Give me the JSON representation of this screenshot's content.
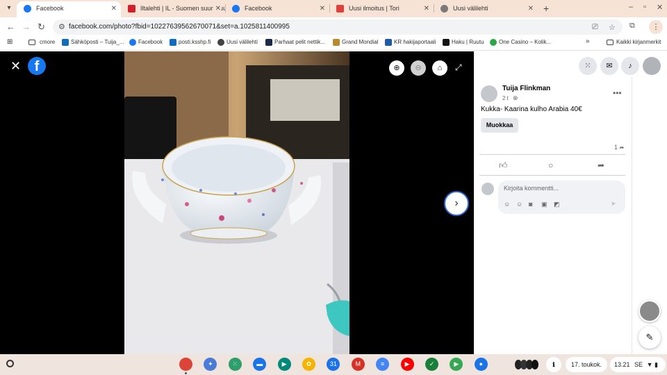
{
  "tabs": [
    {
      "title": "Facebook",
      "icon": "facebook-icon",
      "color": "#1877f2",
      "active": true
    },
    {
      "title": "Iltalehti | IL - Suomen suurin uu",
      "icon": "iltalehti-icon",
      "color": "#d21f2b",
      "active": false
    },
    {
      "title": "Facebook",
      "icon": "facebook-icon",
      "color": "#1877f2",
      "active": false
    },
    {
      "title": "Uusi ilmoitus | Tori",
      "icon": "tori-icon",
      "color": "#e0403a",
      "active": false
    },
    {
      "title": "Uusi välilehti",
      "icon": "chrome-icon",
      "color": "#7a7a7a",
      "active": false
    }
  ],
  "address": {
    "url": "facebook.com/photo?fbid=10227639562670071&set=a.1025811400995"
  },
  "bookmarks": [
    {
      "label": "cmore",
      "icon": "folder-icon",
      "color": "#ffffff"
    },
    {
      "label": "Sähköposti – Tuija_...",
      "icon": "outlook-icon",
      "color": "#0f6cbd"
    },
    {
      "label": "Facebook",
      "icon": "facebook-icon",
      "color": "#1877f2"
    },
    {
      "label": "posti.ksshp.fi",
      "icon": "outlook-icon",
      "color": "#0f6cbd"
    },
    {
      "label": "Uusi välilehti",
      "icon": "chrome-icon",
      "color": "#444444"
    },
    {
      "label": "Parhaat pelit nettik...",
      "icon": "check-icon",
      "color": "#1a2a4a"
    },
    {
      "label": "Grand Mondial",
      "icon": "crown-icon",
      "color": "#b88a2c"
    },
    {
      "label": "KR hakijaportaali",
      "icon": "kr-icon",
      "color": "#1e5aa8"
    },
    {
      "label": "Haku | Ruutu",
      "icon": "ruutu-icon",
      "color": "#111111"
    },
    {
      "label": "One Casino – Kolik...",
      "icon": "onecasino-icon",
      "color": "#29a745"
    }
  ],
  "bookmarks_more": "»",
  "all_bookmarks": "Kaikki kirjanmerkit",
  "post": {
    "author": "Tuija Flinkman",
    "time": "2 t",
    "text": "Kukka- Kaarina kulho Arabia 40€",
    "edit_label": "Muokkaa",
    "share_count": "1",
    "comment_placeholder": "Kirjoita kommentti..."
  },
  "shelf": {
    "apps": [
      {
        "name": "chrome-icon",
        "color": "#db4437",
        "label": ""
      },
      {
        "name": "gemini-icon",
        "color": "#4a7bd8",
        "label": "✦"
      },
      {
        "name": "app-launcher-icon",
        "color": "#2f9e6f",
        "label": "⁙"
      },
      {
        "name": "files-icon",
        "color": "#1a73e8",
        "label": "▬"
      },
      {
        "name": "meet-icon",
        "color": "#00897b",
        "label": "▶"
      },
      {
        "name": "photos-icon",
        "color": "#f4b400",
        "label": "✿"
      },
      {
        "name": "calendar-icon",
        "color": "#1a73e8",
        "label": "31"
      },
      {
        "name": "gmail-icon",
        "color": "#d93025",
        "label": "M"
      },
      {
        "name": "docs-icon",
        "color": "#4285f4",
        "label": "≡"
      },
      {
        "name": "youtube-icon",
        "color": "#ff0000",
        "label": "▶"
      },
      {
        "name": "sheets-icon",
        "color": "#188038",
        "label": "✓"
      },
      {
        "name": "play-store-icon",
        "color": "#34a853",
        "label": "▶"
      },
      {
        "name": "messages-icon",
        "color": "#1a73e8",
        "label": "●"
      }
    ],
    "date": "17. toukok.",
    "time": "13.21",
    "locale": "SE"
  }
}
